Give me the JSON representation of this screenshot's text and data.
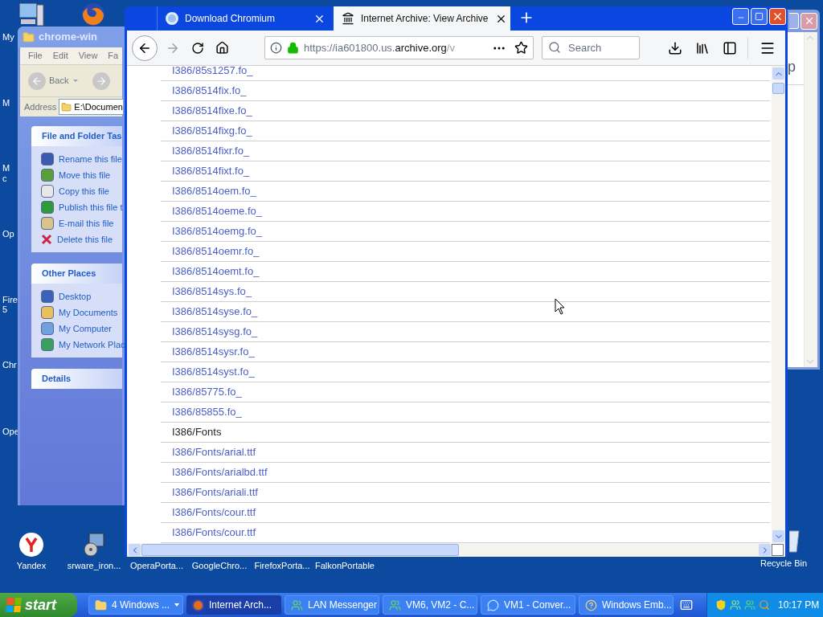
{
  "desktop": {
    "label_fragments": [
      "My",
      "M",
      "M",
      "c",
      "Op",
      "Fire",
      "5",
      "Chr",
      "Ope"
    ],
    "bottom_icons": [
      "Yandex",
      "srware_iron...",
      "OperaPorta...",
      "GoogleChro...",
      "FirefoxPorta...",
      "FalkonPortable"
    ],
    "recycle_bin": "Recycle Bin",
    "background_window": {
      "text": "p"
    }
  },
  "explorer": {
    "title": "chrome-win",
    "menu": [
      "File",
      "Edit",
      "View",
      "Fa"
    ],
    "back": "Back",
    "address_label": "Address",
    "address": "E:\\Documen",
    "panels": [
      {
        "title": "File and Folder Tas",
        "items": [
          "Rename this file",
          "Move this file",
          "Copy this file",
          "Publish this file t",
          "E-mail this file",
          "Delete this file"
        ]
      },
      {
        "title": "Other Places",
        "items": [
          "Desktop",
          "My Documents",
          "My Computer",
          "My Network Plac"
        ]
      },
      {
        "title": "Details"
      }
    ]
  },
  "browser": {
    "tabs": [
      {
        "title": "Download Chromium",
        "selected": false
      },
      {
        "title": "Internet Archive: View Archive",
        "selected": true
      }
    ],
    "url": {
      "host_start": "https://ia601800.us.",
      "domain": "archive.org",
      "path": "/v"
    },
    "search": {
      "placeholder": "Search"
    },
    "rows": [
      {
        "text": "I386/85s1257.fo_",
        "kind": "file"
      },
      {
        "text": "I386/8514fix.fo_",
        "kind": "file"
      },
      {
        "text": "I386/8514fixe.fo_",
        "kind": "file"
      },
      {
        "text": "I386/8514fixg.fo_",
        "kind": "file"
      },
      {
        "text": "I386/8514fixr.fo_",
        "kind": "file"
      },
      {
        "text": "I386/8514fixt.fo_",
        "kind": "file"
      },
      {
        "text": "I386/8514oem.fo_",
        "kind": "file"
      },
      {
        "text": "I386/8514oeme.fo_",
        "kind": "file"
      },
      {
        "text": "I386/8514oemg.fo_",
        "kind": "file"
      },
      {
        "text": "I386/8514oemr.fo_",
        "kind": "file"
      },
      {
        "text": "I386/8514oemt.fo_",
        "kind": "file"
      },
      {
        "text": "I386/8514sys.fo_",
        "kind": "file"
      },
      {
        "text": "I386/8514syse.fo_",
        "kind": "file"
      },
      {
        "text": "I386/8514sysg.fo_",
        "kind": "file"
      },
      {
        "text": "I386/8514sysr.fo_",
        "kind": "file"
      },
      {
        "text": "I386/8514syst.fo_",
        "kind": "file"
      },
      {
        "text": "I386/85775.fo_",
        "kind": "file"
      },
      {
        "text": "I386/85855.fo_",
        "kind": "file"
      },
      {
        "text": "I386/Fonts",
        "kind": "folder"
      },
      {
        "text": "I386/Fonts/arial.ttf",
        "kind": "file"
      },
      {
        "text": "I386/Fonts/arialbd.ttf",
        "kind": "file"
      },
      {
        "text": "I386/Fonts/ariali.ttf",
        "kind": "file"
      },
      {
        "text": "I386/Fonts/cour.ttf",
        "kind": "file"
      },
      {
        "text": "I386/Fonts/cour.ttf",
        "kind": "file"
      }
    ]
  },
  "taskbar": {
    "start": "start",
    "buttons": [
      {
        "label": "4 Windows ...",
        "selected": false,
        "group": true
      },
      {
        "label": "Internet Arch...",
        "selected": true,
        "group": false
      },
      {
        "label": "LAN Messenger",
        "selected": false,
        "group": false
      },
      {
        "label": "VM6, VM2 - C...",
        "selected": false,
        "group": false
      },
      {
        "label": "VM1 - Conver...",
        "selected": false,
        "group": false
      },
      {
        "label": "Windows Emb...",
        "selected": false,
        "group": false
      }
    ],
    "clock": "10:17 PM"
  }
}
